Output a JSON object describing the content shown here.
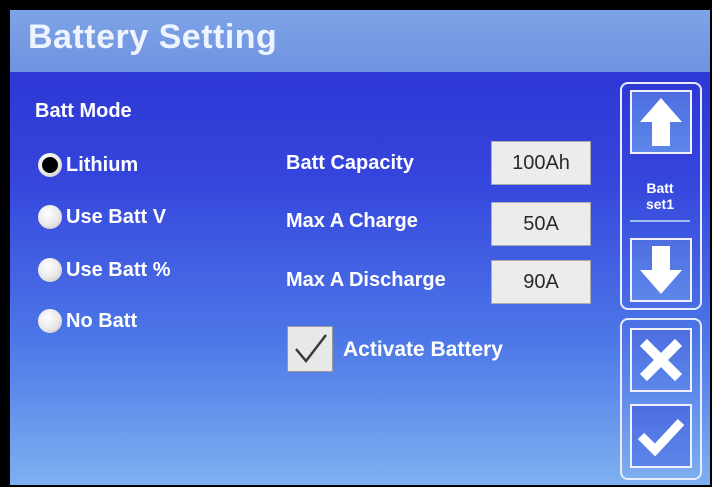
{
  "title": "Battery Setting",
  "batt_mode": {
    "label": "Batt Mode",
    "options": [
      "Lithium",
      "Use Batt V",
      "Use Batt %",
      "No Batt"
    ],
    "selected": "Lithium"
  },
  "fields": {
    "capacity": {
      "label": "Batt Capacity",
      "value": "100Ah"
    },
    "max_charge": {
      "label": "Max A Charge",
      "value": "50A"
    },
    "max_discharge": {
      "label": "Max A Discharge",
      "value": "90A"
    }
  },
  "activate": {
    "label": "Activate Battery",
    "checked": true
  },
  "side": {
    "set_line1": "Batt",
    "set_line2": "set1"
  },
  "icons": {
    "up": "arrow-up-icon",
    "down": "arrow-down-icon",
    "cancel": "close-icon",
    "confirm": "checkmark-icon"
  },
  "colors": {
    "background_top": "#2a2fd0",
    "background_bottom": "#7fb0f0",
    "titlebar": "#7fa3e6"
  }
}
